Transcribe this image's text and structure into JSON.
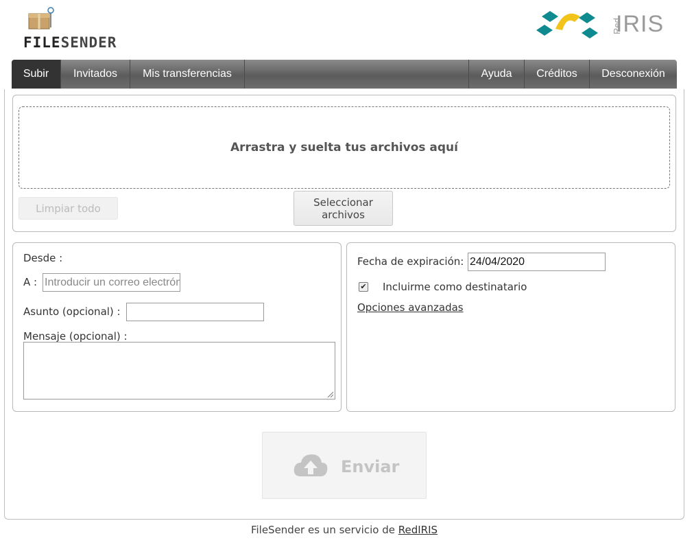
{
  "header": {
    "logo_text_bold": "FILE",
    "logo_text_light": "SENDER",
    "partner_logo": "RedIRIS",
    "partner_logo_red": "Red",
    "partner_logo_iris": "IRIS"
  },
  "menu": {
    "left": [
      {
        "label": "Subir",
        "active": true
      },
      {
        "label": "Invitados",
        "active": false
      },
      {
        "label": "Mis transferencias",
        "active": false
      }
    ],
    "right": [
      {
        "label": "Ayuda"
      },
      {
        "label": "Créditos"
      },
      {
        "label": "Desconexión"
      }
    ]
  },
  "upload": {
    "dropzone_text": "Arrastra y suelta tus archivos aquí",
    "clear_all_label": "Limpiar todo",
    "select_files_label_line1": "Seleccionar",
    "select_files_label_line2": "archivos"
  },
  "form": {
    "from_label": "Desde :",
    "to_label": "A :",
    "to_placeholder": "Introducir un correo electrónico",
    "subject_label": "Asunto (opcional) :",
    "subject_value": "",
    "message_label": "Mensaje (opcional) :",
    "message_value": ""
  },
  "options": {
    "expiry_label": "Fecha de expiración:",
    "expiry_value": "24/04/2020",
    "include_me_label": "Incluirme como destinatario",
    "include_me_checked": true,
    "advanced_label": "Opciones avanzadas"
  },
  "send": {
    "label": "Enviar",
    "icon": "cloud-upload-icon"
  },
  "footer": {
    "text": "FileSender es un servicio de ",
    "link": "RedIRIS"
  },
  "colors": {
    "menu_bg": "#666666",
    "menu_active": "#333333",
    "partner_teal": "#0f8a8f",
    "partner_yellow": "#f2c318"
  }
}
